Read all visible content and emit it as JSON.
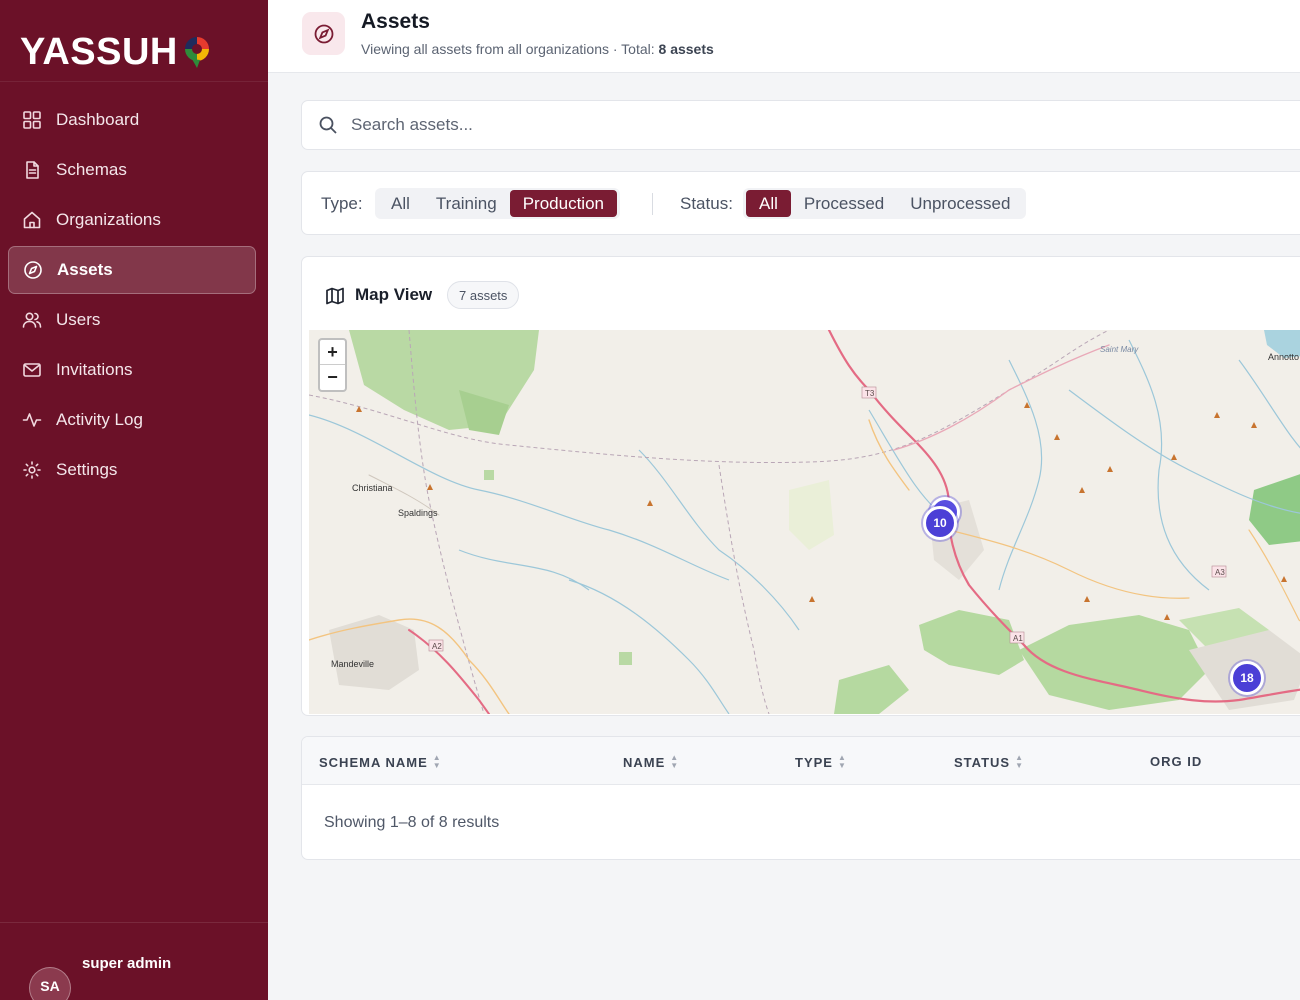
{
  "app": {
    "logo": "YASSUH"
  },
  "sidebar": {
    "items": [
      {
        "label": "Dashboard",
        "icon": "grid-icon"
      },
      {
        "label": "Schemas",
        "icon": "document-icon"
      },
      {
        "label": "Organizations",
        "icon": "home-icon"
      },
      {
        "label": "Assets",
        "icon": "compass-icon",
        "active": true
      },
      {
        "label": "Users",
        "icon": "users-icon"
      },
      {
        "label": "Invitations",
        "icon": "mail-icon"
      },
      {
        "label": "Activity Log",
        "icon": "activity-icon"
      },
      {
        "label": "Settings",
        "icon": "gear-icon"
      }
    ],
    "user": {
      "name": "super admin",
      "initials": "SA"
    }
  },
  "header": {
    "title": "Assets",
    "subtitle_prefix": "Viewing all assets from all organizations · Total: ",
    "total": "8 assets"
  },
  "search": {
    "placeholder": "Search assets...",
    "value": ""
  },
  "filters": {
    "type_label": "Type:",
    "type_options": [
      "All",
      "Training",
      "Production"
    ],
    "type_selected": "Production",
    "status_label": "Status:",
    "status_options": [
      "All",
      "Processed",
      "Unprocessed"
    ],
    "status_selected": "All"
  },
  "map": {
    "title": "Map View",
    "badge": "7 assets",
    "zoom_in": "+",
    "zoom_out": "−",
    "clusters": [
      {
        "count": "10"
      },
      {
        "count": "18"
      }
    ],
    "places": [
      "Christiana",
      "Spaldings",
      "Mandeville",
      "Saint Mary",
      "Annotto",
      "T3",
      "A1",
      "A2",
      "A3"
    ]
  },
  "table": {
    "columns": [
      "SCHEMA NAME",
      "NAME",
      "TYPE",
      "STATUS",
      "ORG ID"
    ],
    "summary": "Showing 1–8 of 8 results"
  },
  "colors": {
    "sidebar_bg": "#6b1128",
    "accent": "#7a1c33",
    "cluster": "#4b3fd6",
    "page_bg": "#f4f5f7"
  }
}
